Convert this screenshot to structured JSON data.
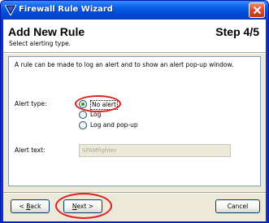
{
  "window": {
    "title": "Firewall Rule Wizard",
    "icon": "firewall-wizard-icon",
    "close_icon": "close-icon"
  },
  "header": {
    "title": "Add New Rule",
    "step": "Step 4/5",
    "subtitle": "Select alerting type."
  },
  "body": {
    "intro": "A rule can be made to log an alert and to show an alert pop-up window.",
    "alert_type_label": "Alert type:",
    "options": [
      {
        "label": "No alert",
        "selected": true
      },
      {
        "label": "Log",
        "selected": false
      },
      {
        "label": "Log and pop-up",
        "selected": false
      }
    ],
    "alert_text_label": "Alert text:",
    "alert_text_value": "SPAMfighter"
  },
  "buttons": {
    "back_prefix": "< ",
    "back_mnemonic": "B",
    "back_rest": "ack",
    "next_mnemonic": "N",
    "next_rest": "ext",
    "next_suffix": " >",
    "cancel": "Cancel"
  },
  "colors": {
    "title_bar": "#0a5fe8",
    "dialog_bg": "#ece9d8",
    "radio_dot": "#21a121",
    "highlight": "#e11e1e"
  }
}
